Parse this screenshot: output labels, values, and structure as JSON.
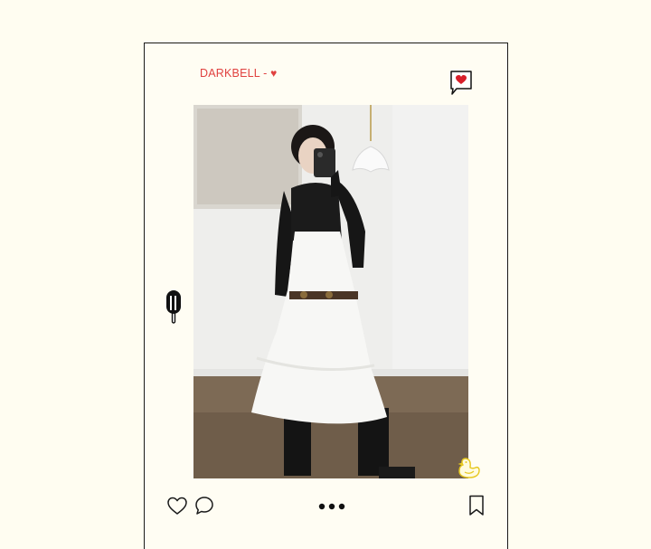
{
  "post": {
    "brand_label": "DARKBELL - ",
    "brand_heart": "♥",
    "accent_color": "#e0413f"
  },
  "icons": {
    "message": "speech-bubble-heart-icon",
    "sticker_left": "popsicle-icon",
    "sticker_right": "duck-icon",
    "like": "heart-outline-icon",
    "comment": "comment-bubble-icon",
    "more": "more-dots-icon",
    "save": "bookmark-icon"
  }
}
